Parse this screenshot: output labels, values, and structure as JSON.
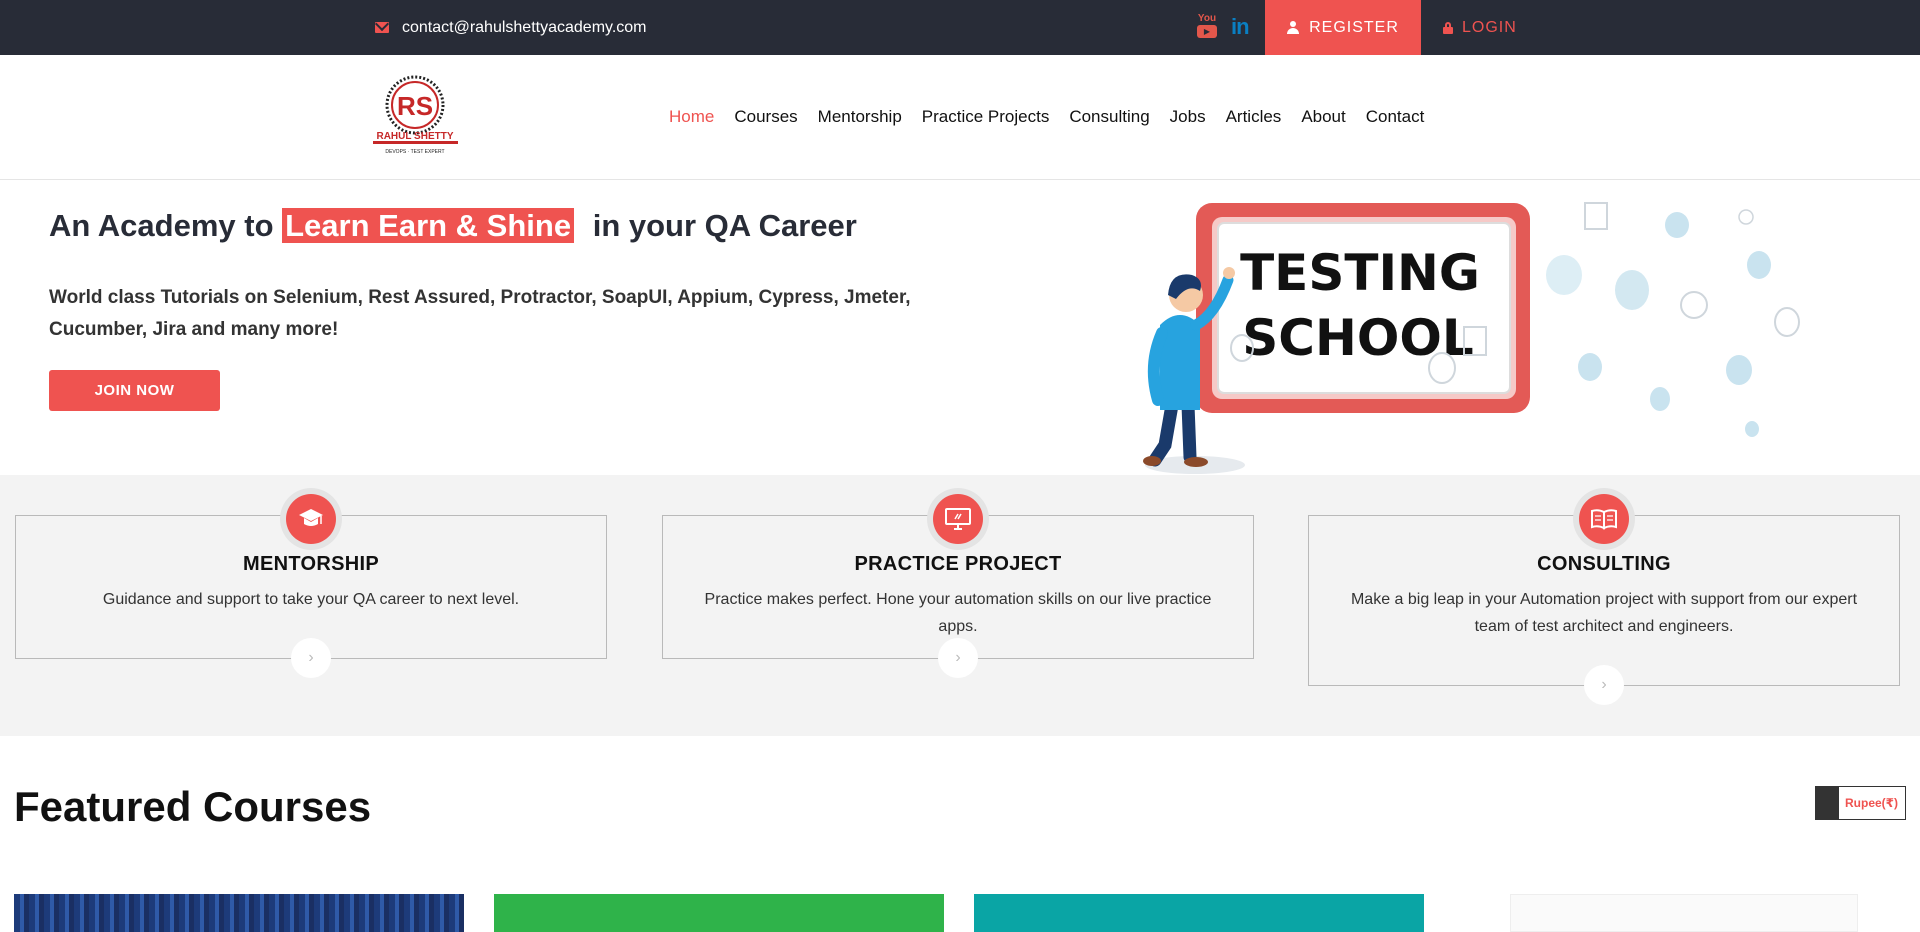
{
  "topbar": {
    "email": "contact@rahulshettyacademy.com",
    "youtube_label": "You",
    "linkedin_label": "in",
    "register_label": "REGISTER",
    "login_label": "LOGIN",
    "accent": "#ef5350",
    "background": "#282c37"
  },
  "logo": {
    "initials": "RS",
    "name": "RAHUL SHETTY",
    "tagline": "DEVOPS · TEST EXPERT"
  },
  "nav": {
    "items": [
      "Home",
      "Courses",
      "Mentorship",
      "Practice Projects",
      "Consulting",
      "Jobs",
      "Articles",
      "About",
      "Contact"
    ],
    "active": "Home"
  },
  "hero": {
    "title_pre": "An Academy to ",
    "title_highlight": "Learn Earn & Shine",
    "title_post": " in your QA Career",
    "subtitle": "World class Tutorials on Selenium, Rest Assured, Protractor, SoapUI, Appium, Cypress, Jmeter, Cucumber, Jira and many more!",
    "cta": "JOIN NOW",
    "illustration_line1": "TESTING",
    "illustration_line2": "SCHOOL"
  },
  "services": [
    {
      "title": "MENTORSHIP",
      "text": "Guidance and support to take your QA career to next level.",
      "icon": "graduation-cap-icon"
    },
    {
      "title": "PRACTICE PROJECT",
      "text": "Practice makes perfect. Hone your automation skills on our live practice apps.",
      "icon": "monitor-icon"
    },
    {
      "title": "CONSULTING",
      "text": "Make a big leap in your Automation project with support from our expert team of test architect and engineers.",
      "icon": "open-book-icon"
    }
  ],
  "featured": {
    "title": "Featured Courses",
    "currency": "Rupee(₹)"
  }
}
